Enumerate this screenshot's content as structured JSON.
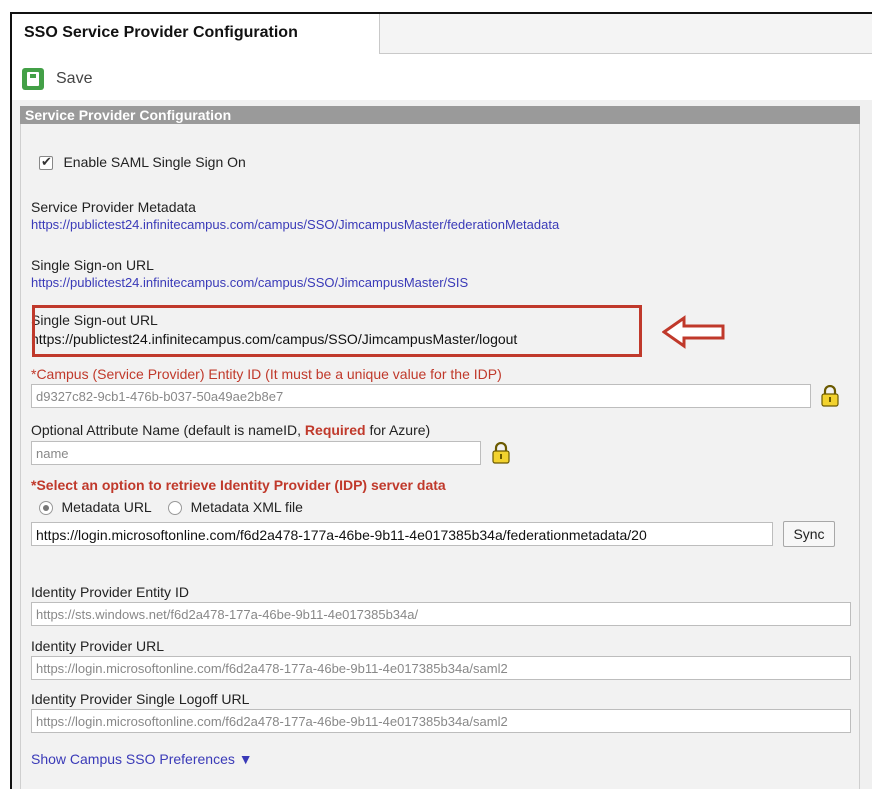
{
  "tab": {
    "title": "SSO Service Provider Configuration"
  },
  "toolbar": {
    "save_label": "Save"
  },
  "section": {
    "title": "Service Provider Configuration"
  },
  "enable_saml": {
    "label": "Enable SAML Single Sign On",
    "checked": true
  },
  "sp_metadata": {
    "label": "Service Provider Metadata",
    "url": "https://publictest24.infinitecampus.com/campus/SSO/JimcampusMaster/federationMetadata"
  },
  "sso_url": {
    "label": "Single Sign-on URL",
    "url": "https://publictest24.infinitecampus.com/campus/SSO/JimcampusMaster/SIS"
  },
  "slo_url": {
    "label": "Single Sign-out URL",
    "url": "https://publictest24.infinitecampus.com/campus/SSO/JimcampusMaster/logout"
  },
  "entity_id": {
    "label": "*Campus (Service Provider) Entity ID (It must be a unique value for the IDP)",
    "value": "d9327c82-9cb1-476b-b037-50a49ae2b8e7"
  },
  "attr_name": {
    "label_part1": "Optional Attribute Name (default is nameID, ",
    "label_required": "Required",
    "label_part2": " for Azure)",
    "value": "name"
  },
  "idp_option": {
    "label": "*Select an option to retrieve Identity Provider (IDP) server data",
    "option_metadata_url": "Metadata URL",
    "option_metadata_xml": "Metadata XML file",
    "selected": "Metadata URL",
    "url_value": "https://login.microsoftonline.com/f6d2a478-177a-46be-9b11-4e017385b34a/federationmetadata/20",
    "sync_label": "Sync"
  },
  "idp_entity_id": {
    "label": "Identity Provider Entity ID",
    "value": "https://sts.windows.net/f6d2a478-177a-46be-9b11-4e017385b34a/"
  },
  "idp_url": {
    "label": "Identity Provider URL",
    "value": "https://login.microsoftonline.com/f6d2a478-177a-46be-9b11-4e017385b34a/saml2"
  },
  "idp_logoff_url": {
    "label": "Identity Provider Single Logoff URL",
    "value": "https://login.microsoftonline.com/f6d2a478-177a-46be-9b11-4e017385b34a/saml2"
  },
  "preferences_link": {
    "label": "Show Campus SSO Preferences ▼"
  },
  "colors": {
    "highlight": "#c0392b",
    "link": "#3a3ab8",
    "required": "#c0392b",
    "save_icon": "#43a047",
    "section_header": "#9a9a9a"
  },
  "icons": {
    "save": "save-icon",
    "lock": "lock-icon",
    "arrow": "left-arrow-icon"
  }
}
